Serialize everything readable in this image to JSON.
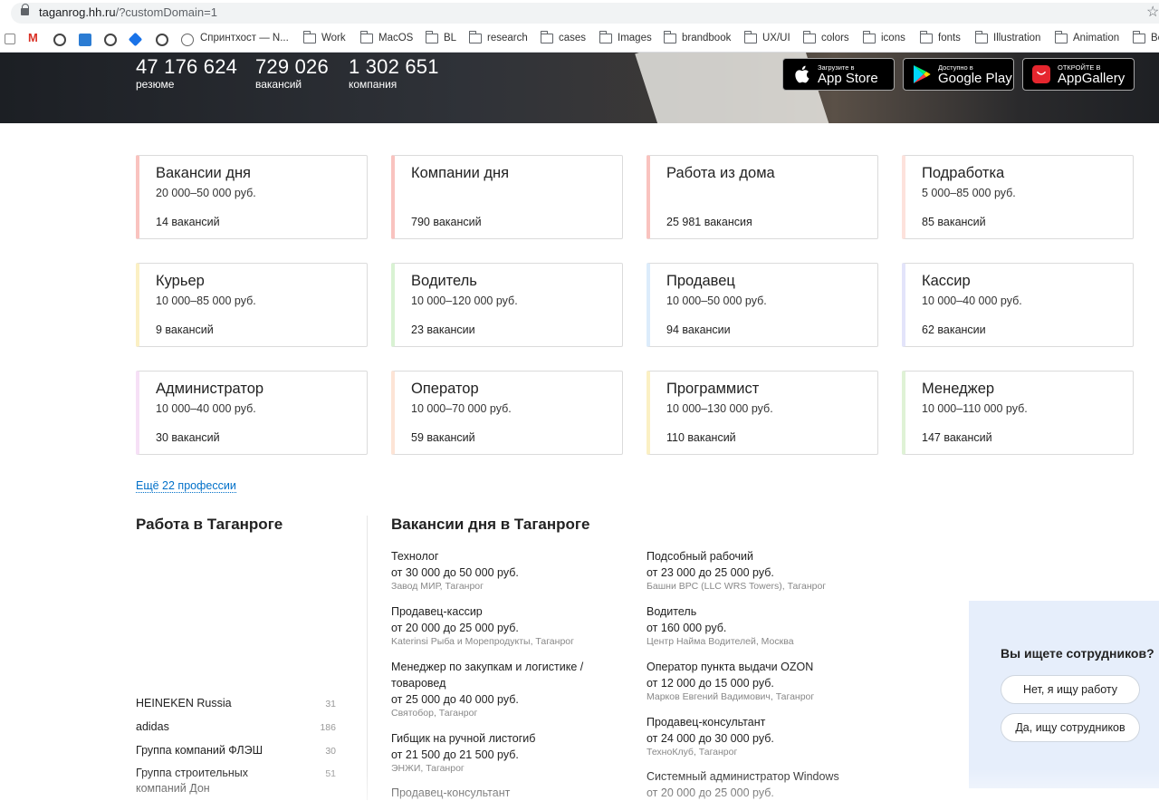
{
  "browser": {
    "url_host": "taganrog.hh.ru",
    "url_path": "/?customDomain=1",
    "bookmarks": [
      {
        "label": "Спринтхост — N..."
      },
      {
        "label": "Work"
      },
      {
        "label": "MacOS"
      },
      {
        "label": "BL"
      },
      {
        "label": "research"
      },
      {
        "label": "cases"
      },
      {
        "label": "Images"
      },
      {
        "label": "brandbook"
      },
      {
        "label": "UX/UI"
      },
      {
        "label": "colors"
      },
      {
        "label": "icons"
      },
      {
        "label": "fonts"
      },
      {
        "label": "Illustration"
      },
      {
        "label": "Animation"
      },
      {
        "label": "Be"
      }
    ]
  },
  "hero": {
    "stats": [
      {
        "value": "47 176 624",
        "label": "резюме"
      },
      {
        "value": "729 026",
        "label": "вакансий"
      },
      {
        "value": "1 302 651",
        "label": "компания"
      }
    ],
    "stores": [
      {
        "small": "Загрузите в",
        "big": "App Store"
      },
      {
        "small": "Доступно в",
        "big": "Google Play"
      },
      {
        "small": "ОТКРОЙТЕ В",
        "big": "AppGallery"
      }
    ]
  },
  "cards": [
    {
      "title": "Вакансии дня",
      "salary": "20 000–50 000 руб.",
      "count": "14 вакансий",
      "accent": "#f9c3bf"
    },
    {
      "title": "Компании дня",
      "salary": "",
      "count": "790 вакансий",
      "accent": "#f9c3bf"
    },
    {
      "title": "Работа из дома",
      "salary": "",
      "count": "25 981 вакансия",
      "accent": "#f9c3bf"
    },
    {
      "title": "Подработка",
      "salary": "5 000–85 000 руб.",
      "count": "85 вакансий",
      "accent": "#fde2dc"
    },
    {
      "title": "Курьер",
      "salary": "10 000–85 000 руб.",
      "count": "9 вакансий",
      "accent": "#fbf0c4"
    },
    {
      "title": "Водитель",
      "salary": "10 000–120 000 руб.",
      "count": "23 вакансии",
      "accent": "#d9f2d3"
    },
    {
      "title": "Продавец",
      "salary": "10 000–50 000 руб.",
      "count": "94 вакансии",
      "accent": "#dcecfb"
    },
    {
      "title": "Кассир",
      "salary": "10 000–40 000 руб.",
      "count": "62 вакансии",
      "accent": "#e3e4fa"
    },
    {
      "title": "Администратор",
      "salary": "10 000–40 000 руб.",
      "count": "30 вакансий",
      "accent": "#f6e0f6"
    },
    {
      "title": "Оператор",
      "salary": "10 000–70 000 руб.",
      "count": "59 вакансий",
      "accent": "#fde4d6"
    },
    {
      "title": "Программист",
      "salary": "10 000–130 000 руб.",
      "count": "110 вакансий",
      "accent": "#fbf0c4"
    },
    {
      "title": "Менеджер",
      "salary": "10 000–110 000 руб.",
      "count": "147 вакансий",
      "accent": "#dff2d6"
    }
  ],
  "more_link": "Ещё 22 профессии",
  "work_section": {
    "title": "Работа в Таганроге",
    "companies": [
      {
        "name": "HEINEKEN Russia",
        "count": "31"
      },
      {
        "name": "adidas",
        "count": "186"
      },
      {
        "name": "Группа компаний ФЛЭШ",
        "count": "30"
      },
      {
        "name": "Группа строительных компаний Дон",
        "count": "51"
      }
    ]
  },
  "vacancies_section": {
    "title": "Вакансии дня в Таганроге",
    "col1": [
      {
        "title": "Технолог",
        "salary": "от 30 000 до 50 000 руб.",
        "employer": "Завод МИР, Таганрог"
      },
      {
        "title": "Продавец-кассир",
        "salary": "от 20 000 до 25 000 руб.",
        "employer": "Katerinsi Рыба и Морепродукты, Таганрог"
      },
      {
        "title": "Менеджер по закупкам и логистике / товаровед",
        "salary": "от 25 000 до 40 000 руб.",
        "employer": "Святобор, Таганрог"
      },
      {
        "title": "Гибщик на ручной листогиб",
        "salary": "от 21 500 до 21 500 руб.",
        "employer": "ЭНЖИ, Таганрог"
      },
      {
        "title": "Продавец-консультант",
        "salary": "",
        "employer": ""
      }
    ],
    "col2": [
      {
        "title": "Подсобный рабочий",
        "salary": "от 23 000 до 25 000 руб.",
        "employer": "Башни ВРС (LLC WRS Towers), Таганрог"
      },
      {
        "title": "Водитель",
        "salary": "от 160 000 руб.",
        "employer": "Центр Найма Водителей, Москва"
      },
      {
        "title": "Оператор пункта выдачи OZON",
        "salary": "от 12 000 до 15 000 руб.",
        "employer": "Марков Евгений Вадимович, Таганрог"
      },
      {
        "title": "Продавец-консультант",
        "salary": "от 24 000 до 30 000 руб.",
        "employer": "ТехноКлуб, Таганрог"
      },
      {
        "title": "Системный администратор Windows",
        "salary": "от 20 000 до 25 000 руб.",
        "employer": ""
      }
    ]
  },
  "employer_widget": {
    "question": "Вы ищете сотрудников?",
    "no_label": "Нет, я ищу работу",
    "yes_label": "Да, ищу сотрудников"
  }
}
